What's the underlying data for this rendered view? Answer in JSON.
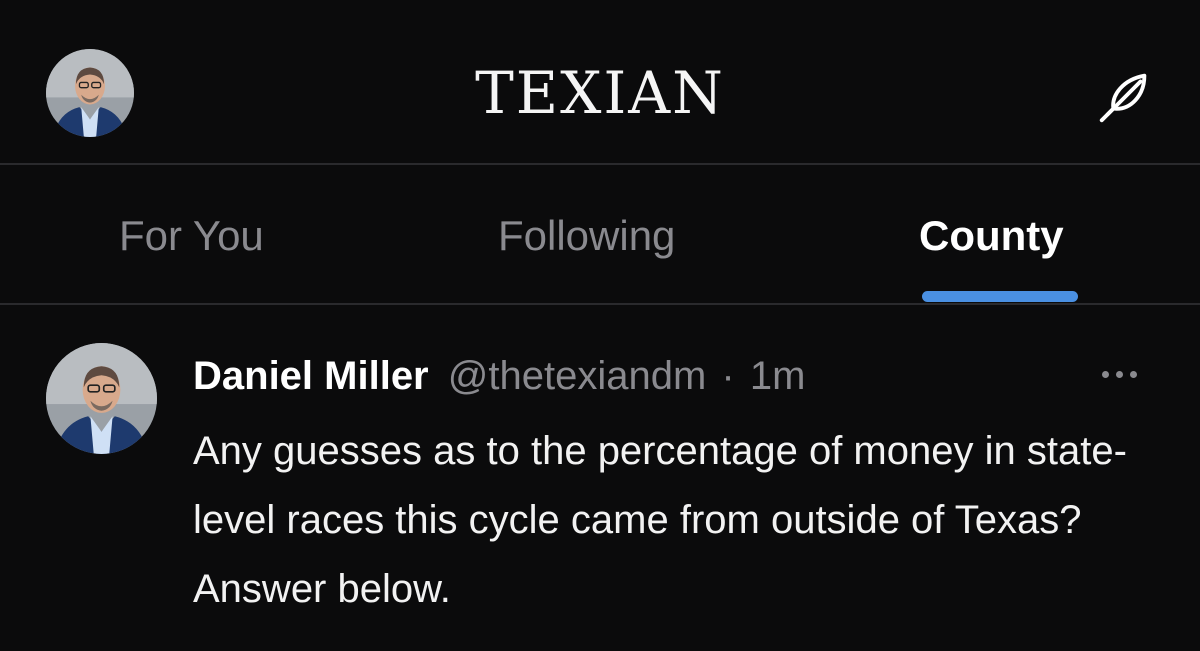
{
  "header": {
    "app_title": "TEXIAN",
    "avatar_icon": "user-avatar",
    "compose_icon": "feather-icon"
  },
  "tabs": [
    {
      "label": "For You",
      "active": false
    },
    {
      "label": "Following",
      "active": false
    },
    {
      "label": "County",
      "active": true
    }
  ],
  "colors": {
    "background": "#0b0b0c",
    "accent": "#4a90e2",
    "muted_text": "#8a8a8f"
  },
  "post": {
    "author_name": "Daniel Miller",
    "handle": "@thetexiandm",
    "separator": "·",
    "time": "1m",
    "text": "Any guesses as to the percentage of money in state-level races this cycle came from outside of Texas? Answer below.",
    "more_icon": "more-options-icon"
  }
}
